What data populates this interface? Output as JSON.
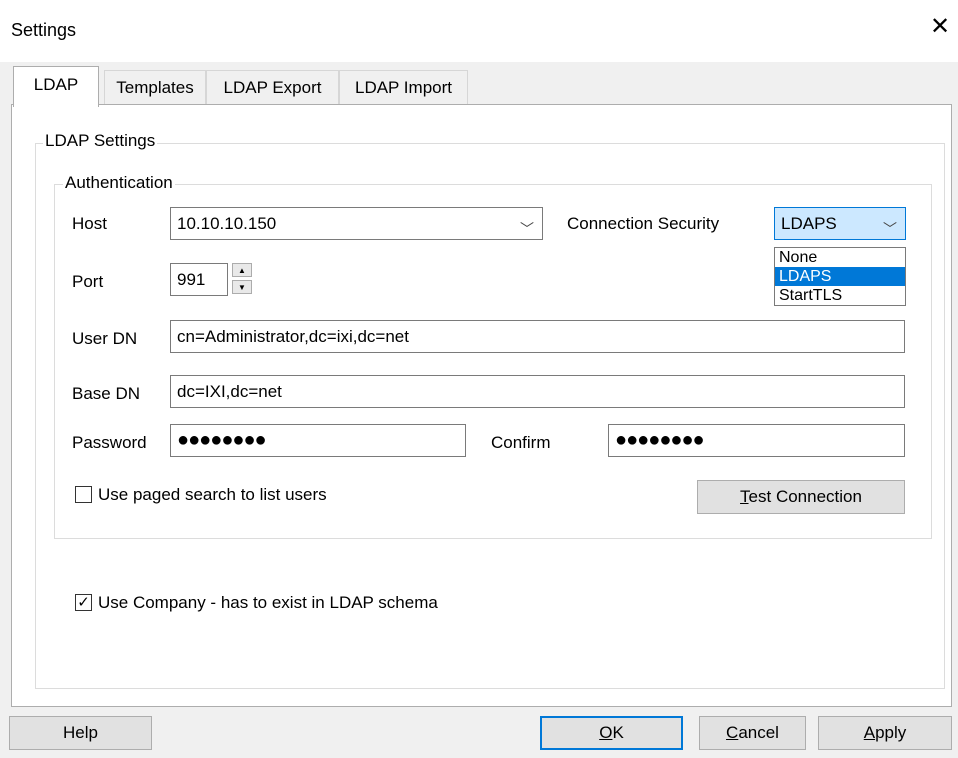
{
  "window": {
    "title": "Settings",
    "close_glyph": "✕"
  },
  "tabs": [
    {
      "label": "LDAP"
    },
    {
      "label": "Templates"
    },
    {
      "label": "LDAP Export"
    },
    {
      "label": "LDAP Import"
    }
  ],
  "ldap_settings": {
    "legend": "LDAP Settings",
    "authentication": {
      "legend": "Authentication",
      "host_label": "Host",
      "host_value": "10.10.10.150",
      "connection_security_label": "Connection Security",
      "connection_security_value": "LDAPS",
      "connection_security_options": [
        "None",
        "LDAPS",
        "StartTLS"
      ],
      "port_label": "Port",
      "port_value": "991",
      "user_dn_label": "User DN",
      "user_dn_value": "cn=Administrator,dc=ixi,dc=net",
      "base_dn_label": "Base DN",
      "base_dn_value": "dc=IXI,dc=net",
      "password_label": "Password",
      "password_value": "●●●●●●●●",
      "confirm_label": "Confirm",
      "confirm_value": "●●●●●●●●",
      "paged_search_label": "Use paged search to list users",
      "paged_search_checked": false,
      "test_connection_label": "Test Connection"
    },
    "use_company_label": "Use Company - has to exist in LDAP schema",
    "use_company_checked": true,
    "check_glyph": "✓"
  },
  "buttons": {
    "help": "Help",
    "ok": "OK",
    "cancel": "Cancel",
    "apply": "Apply"
  },
  "icons": {
    "chevron": "﹀",
    "spin_up": "▲",
    "spin_down": "▼"
  }
}
